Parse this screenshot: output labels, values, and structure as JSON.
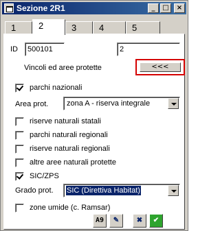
{
  "window": {
    "title": "Sezione 2R1",
    "min_label": "_",
    "max_label": "□",
    "close_label": "×"
  },
  "tabs": [
    {
      "label": "1"
    },
    {
      "label": "2",
      "active": true
    },
    {
      "label": "3"
    },
    {
      "label": "4"
    },
    {
      "label": "5"
    }
  ],
  "record": {
    "id_label": "ID",
    "id_value": "500101",
    "second_value": "2"
  },
  "vincoli": {
    "heading": "Vincoli ed aree protette",
    "collapse_button_label": "<<<"
  },
  "parchi_nazionali": {
    "label": "parchi nazionali",
    "checked": true
  },
  "area_prot": {
    "label": "Area prot.",
    "value": "zona A - riserva integrale"
  },
  "checkboxes": [
    {
      "label": "riserve naturali statali",
      "checked": false
    },
    {
      "label": "parchi naturali regionali",
      "checked": false
    },
    {
      "label": "riserve naturali regionali",
      "checked": false
    },
    {
      "label": "altre aree naturali protette",
      "checked": false
    },
    {
      "label": "SIC/ZPS",
      "checked": true
    }
  ],
  "grado_prot": {
    "label": "Grado prot.",
    "value": "SIC (Direttiva Habitat)"
  },
  "zone_umide": {
    "label": "zone umide (c. Ramsar)",
    "checked": false
  },
  "toolbar": {
    "icons": [
      {
        "name": "spellcheck-icon",
        "text": "A9"
      },
      {
        "name": "edit-pencil-icon",
        "text": "✎"
      },
      {
        "name": "cancel-x-icon",
        "text": "✖"
      },
      {
        "name": "confirm-check-icon",
        "text": "✔"
      }
    ]
  },
  "colors": {
    "titlebar": "#0a246a",
    "highlight_border": "#d40000",
    "confirm": "#2ea42e"
  }
}
